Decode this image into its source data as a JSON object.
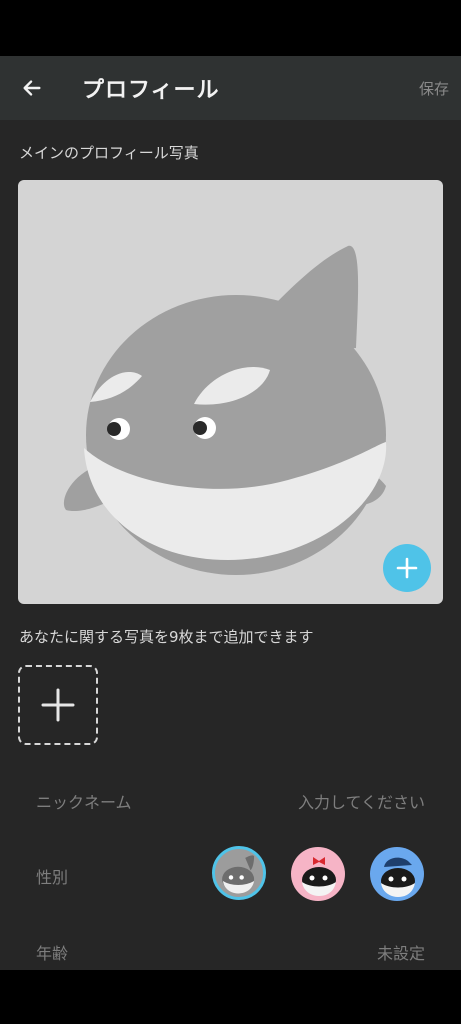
{
  "header": {
    "back_icon": "arrow-left-icon",
    "title": "プロフィール",
    "save_label": "保存"
  },
  "main_photo_section": {
    "label": "メインのプロフィール写真",
    "image": "orca-mascot-placeholder",
    "add_icon": "plus-icon",
    "accent_color": "#4fc3e8"
  },
  "additional_photos": {
    "label": "あなたに関する写真を9枚まで追加できます",
    "add_icon": "plus-icon"
  },
  "fields": {
    "nickname": {
      "label": "ニックネーム",
      "placeholder": "入力してください"
    },
    "gender": {
      "label": "性別",
      "options": [
        {
          "name": "neutral",
          "color": "#9c9c9c",
          "selected": true
        },
        {
          "name": "female",
          "color": "#f6b4c6",
          "selected": false
        },
        {
          "name": "male",
          "color": "#6aa8ee",
          "selected": false
        }
      ]
    },
    "age": {
      "label": "年齢",
      "value": "未設定"
    }
  }
}
